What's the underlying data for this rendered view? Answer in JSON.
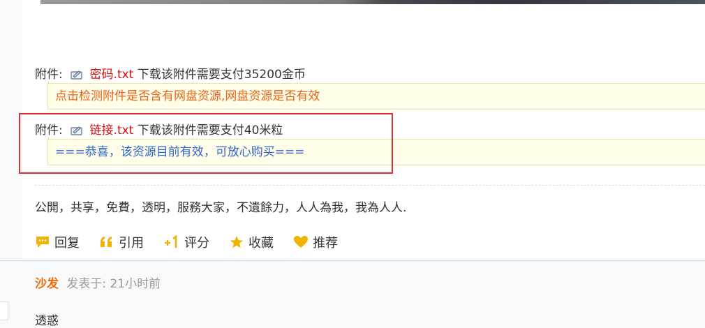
{
  "attachments": [
    {
      "label": "附件:",
      "icon": "attachment-file-icon",
      "filename": "密码.txt",
      "price_text": "下载该附件需要支付35200金币",
      "info": "点击检测附件是否含有网盘资源,网盘资源是否有效",
      "info_color": "#e6651a"
    },
    {
      "label": "附件:",
      "icon": "attachment-file-icon",
      "filename": "链接.txt",
      "price_text": "下载该附件需要支付40米粒",
      "info": "===恭喜，该资源目前有效，可放心购买===",
      "info_color": "#3366cc"
    }
  ],
  "signature": "公開，共享，免費，透明，服務大家，不遺餘力，人人為我，我為人人.",
  "actions": {
    "reply": "回复",
    "quote": "引用",
    "rate": "评分",
    "favorite": "收藏",
    "recommend": "推荐"
  },
  "reply": {
    "floor": "沙发",
    "meta": "发表于: 21小时前",
    "body": "透惑"
  },
  "colors": {
    "link_red": "#cc1111",
    "floor_orange": "#f26c0a",
    "highlight_red": "#e03030",
    "icon_gold": "#f0b400"
  }
}
